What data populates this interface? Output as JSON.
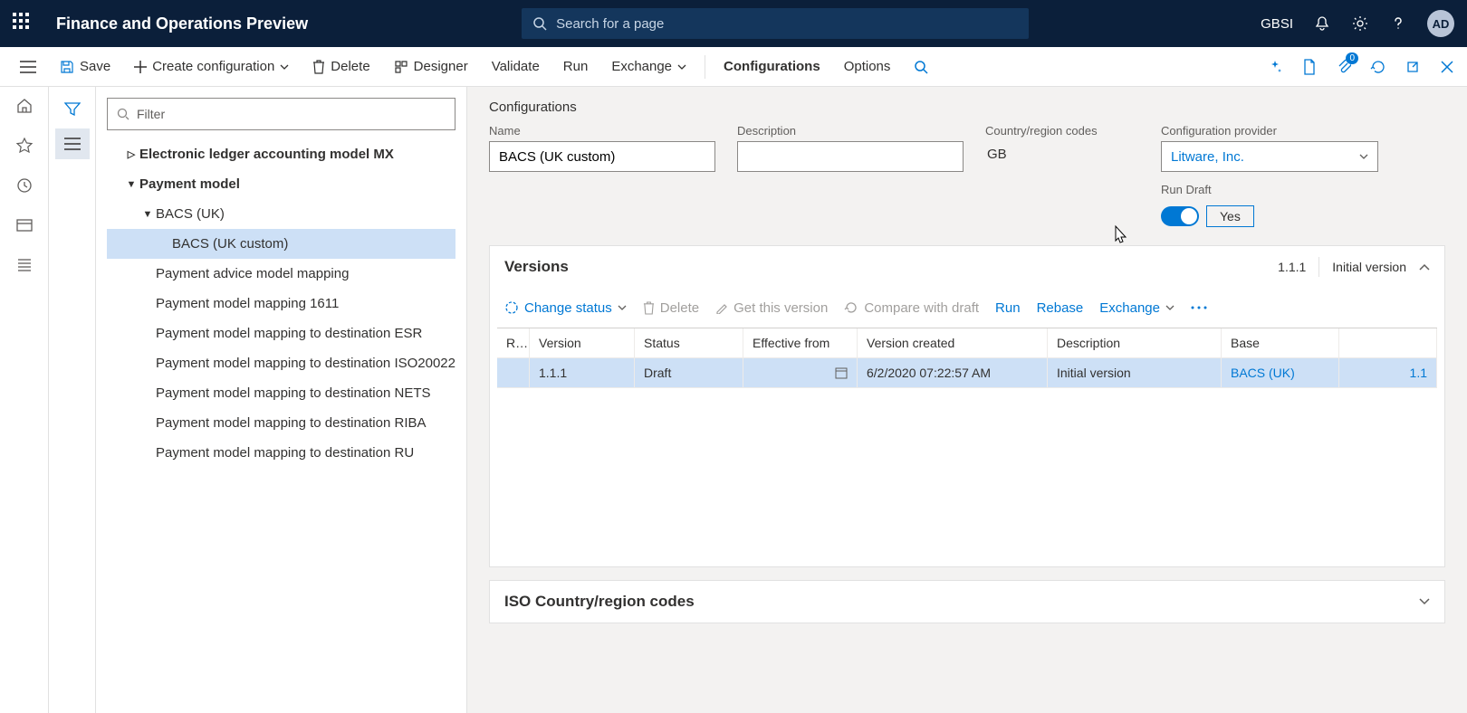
{
  "topbar": {
    "app_title": "Finance and Operations Preview",
    "search_placeholder": "Search for a page",
    "company": "GBSI",
    "avatar": "AD"
  },
  "cmdbar": {
    "save": "Save",
    "create_config": "Create configuration",
    "delete": "Delete",
    "designer": "Designer",
    "validate": "Validate",
    "run": "Run",
    "exchange": "Exchange",
    "configurations": "Configurations",
    "options": "Options",
    "notif_badge": "0"
  },
  "tree": {
    "filter_placeholder": "Filter",
    "items": [
      {
        "level": 1,
        "caret": "▷",
        "label": "Electronic ledger accounting model MX",
        "selected": false
      },
      {
        "level": 1,
        "caret": "▼",
        "label": "Payment model",
        "selected": false
      },
      {
        "level": 2,
        "caret": "▼",
        "label": "BACS (UK)",
        "selected": false
      },
      {
        "level": 3,
        "caret": "",
        "label": "BACS (UK custom)",
        "selected": true
      },
      {
        "level": 2,
        "caret": "",
        "label": "Payment advice model mapping",
        "selected": false
      },
      {
        "level": 2,
        "caret": "",
        "label": "Payment model mapping 1611",
        "selected": false
      },
      {
        "level": 2,
        "caret": "",
        "label": "Payment model mapping to destination ESR",
        "selected": false
      },
      {
        "level": 2,
        "caret": "",
        "label": "Payment model mapping to destination ISO20022",
        "selected": false
      },
      {
        "level": 2,
        "caret": "",
        "label": "Payment model mapping to destination NETS",
        "selected": false
      },
      {
        "level": 2,
        "caret": "",
        "label": "Payment model mapping to destination RIBA",
        "selected": false
      },
      {
        "level": 2,
        "caret": "",
        "label": "Payment model mapping to destination RU",
        "selected": false
      }
    ]
  },
  "form": {
    "section_title": "Configurations",
    "labels": {
      "name": "Name",
      "description": "Description",
      "region": "Country/region codes",
      "provider": "Configuration provider",
      "run_draft": "Run Draft"
    },
    "name": "BACS (UK custom)",
    "description": "",
    "region": "GB",
    "provider": "Litware, Inc.",
    "run_draft_value": "Yes"
  },
  "versions": {
    "title": "Versions",
    "summary_version": "1.1.1",
    "summary_desc": "Initial version",
    "toolbar": {
      "change_status": "Change status",
      "delete": "Delete",
      "get": "Get this version",
      "compare": "Compare with draft",
      "run": "Run",
      "rebase": "Rebase",
      "exchange": "Exchange"
    },
    "columns": {
      "rmark": "R...",
      "version": "Version",
      "status": "Status",
      "eff": "Effective from",
      "created": "Version created",
      "desc": "Description",
      "base": "Base"
    },
    "rows": [
      {
        "version": "1.1.1",
        "status": "Draft",
        "eff": "",
        "created": "6/2/2020 07:22:57 AM",
        "desc": "Initial version",
        "base": "BACS (UK)",
        "basev": "1.1"
      }
    ]
  },
  "iso": {
    "title": "ISO Country/region codes"
  }
}
